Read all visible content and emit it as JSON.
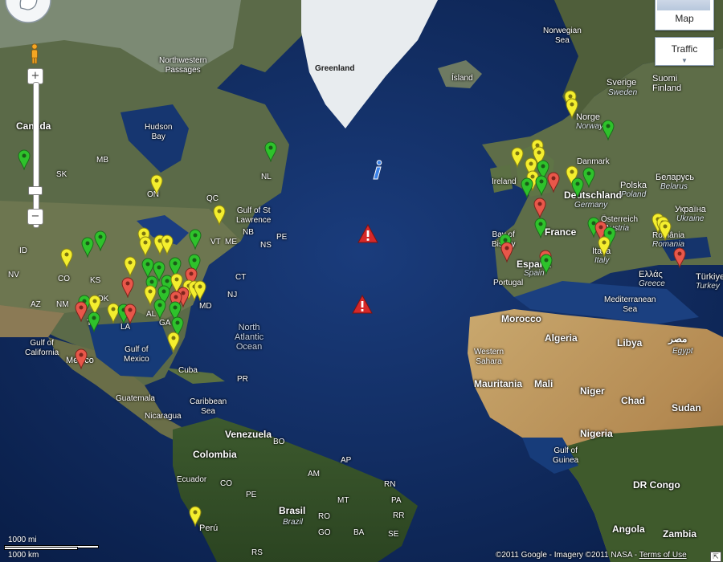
{
  "controls": {
    "zoom_in": "+",
    "zoom_out": "−",
    "map_type_label": "Map",
    "traffic_label": "Traffic",
    "traffic_arrow": "▼"
  },
  "scale": {
    "miles": "1000 mi",
    "km": "1000 km"
  },
  "attribution": {
    "text": "©2011 Google - Imagery ©2011 NASA - ",
    "terms": "Terms of Use",
    "corner": "⇱"
  },
  "colors": {
    "red": "#e8574a",
    "yellow": "#f4ee2e",
    "green": "#2ec22b",
    "warning": "#d62828",
    "info": "#2a6dd8"
  },
  "labels": {
    "canada": "Canada",
    "northwestern_passages": "Northwestern\nPassages",
    "hudson_bay": "Hudson\nBay",
    "greenland": "Greenland",
    "norwegian_sea": "Norwegian\nSea",
    "island": "Ísland",
    "sverige": "Sverige",
    "sweden": "Sweden",
    "suomi": "Suomi\nFinland",
    "norge": "Norge",
    "norway": "Norway",
    "danmark": "Danmark",
    "ireland": "Ireland",
    "deutschland": "Deutschland",
    "germany": "Germany",
    "polska": "Polska",
    "poland": "Poland",
    "belarus": "Беларусь",
    "belarus_en": "Belarus",
    "ukraine": "Україна",
    "ukraine_en": "Ukraine",
    "france": "France",
    "osterreich": "Österreich",
    "austria": "Austria",
    "romania": "România",
    "romania_en": "Romania",
    "bay_of_biscay": "Bay of\nBiscay",
    "espana": "España",
    "spain": "Spain",
    "portugal": "Portugal",
    "italia": "Italia",
    "italy": "Italy",
    "ellas": "Ελλάς",
    "greece": "Greece",
    "turkiye": "Türkiye",
    "turkey": "Turkey",
    "mediterranean": "Mediterranean\nSea",
    "morocco": "Morocco",
    "algeria": "Algeria",
    "libya": "Libya",
    "egypt_ar": "مصر",
    "egypt": "Egypt",
    "western_sahara": "Western\nSahara",
    "mauritania": "Mauritania",
    "mali": "Mali",
    "niger": "Niger",
    "chad": "Chad",
    "sudan": "Sudan",
    "nigeria": "Nigeria",
    "gulf_of_guinea": "Gulf of\nGuinea",
    "dr_congo": "DR Congo",
    "angola": "Angola",
    "zambia": "Zambia",
    "north_atlantic": "North\nAtlantic\nOcean",
    "gulf_stlawrence": "Gulf of St\nLawrence",
    "gulf_mexico": "Gulf of\nMexico",
    "gulf_california": "Gulf of\nCalifornia",
    "mexico": "México",
    "cuba": "Cuba",
    "caribbean": "Caribbean\nSea",
    "guatemala": "Guatemala",
    "nicaragua": "Nicaragua",
    "venezuela": "Venezuela",
    "colombia": "Colombia",
    "ecuador": "Ecuador",
    "peru": "Perú",
    "brasil": "Brasil",
    "brazil": "Brazil",
    "sk": "SK",
    "mb": "MB",
    "on": "ON",
    "qc": "QC",
    "nl": "NL",
    "nb": "NB",
    "ns": "NS",
    "pe": "PE",
    "id": "ID",
    "nv": "NV",
    "co": "CO",
    "ks": "KS",
    "ok": "OK",
    "az": "AZ",
    "nm": "NM",
    "tx": "TX",
    "la": "LA",
    "al": "AL",
    "ga": "GA",
    "md": "MD",
    "nj": "NJ",
    "ct": "CT",
    "vt": "VT",
    "me": "ME",
    "pr": "PR",
    "co_sa": "CO",
    "pe_sa": "PE",
    "bo": "BO",
    "ap": "AP",
    "rn": "RN",
    "pa": "PA",
    "rr": "RR",
    "am": "AM",
    "mt": "MT",
    "ba": "BA",
    "rs": "RS",
    "go": "GO",
    "se": "SE",
    "ro": "RO"
  }
}
